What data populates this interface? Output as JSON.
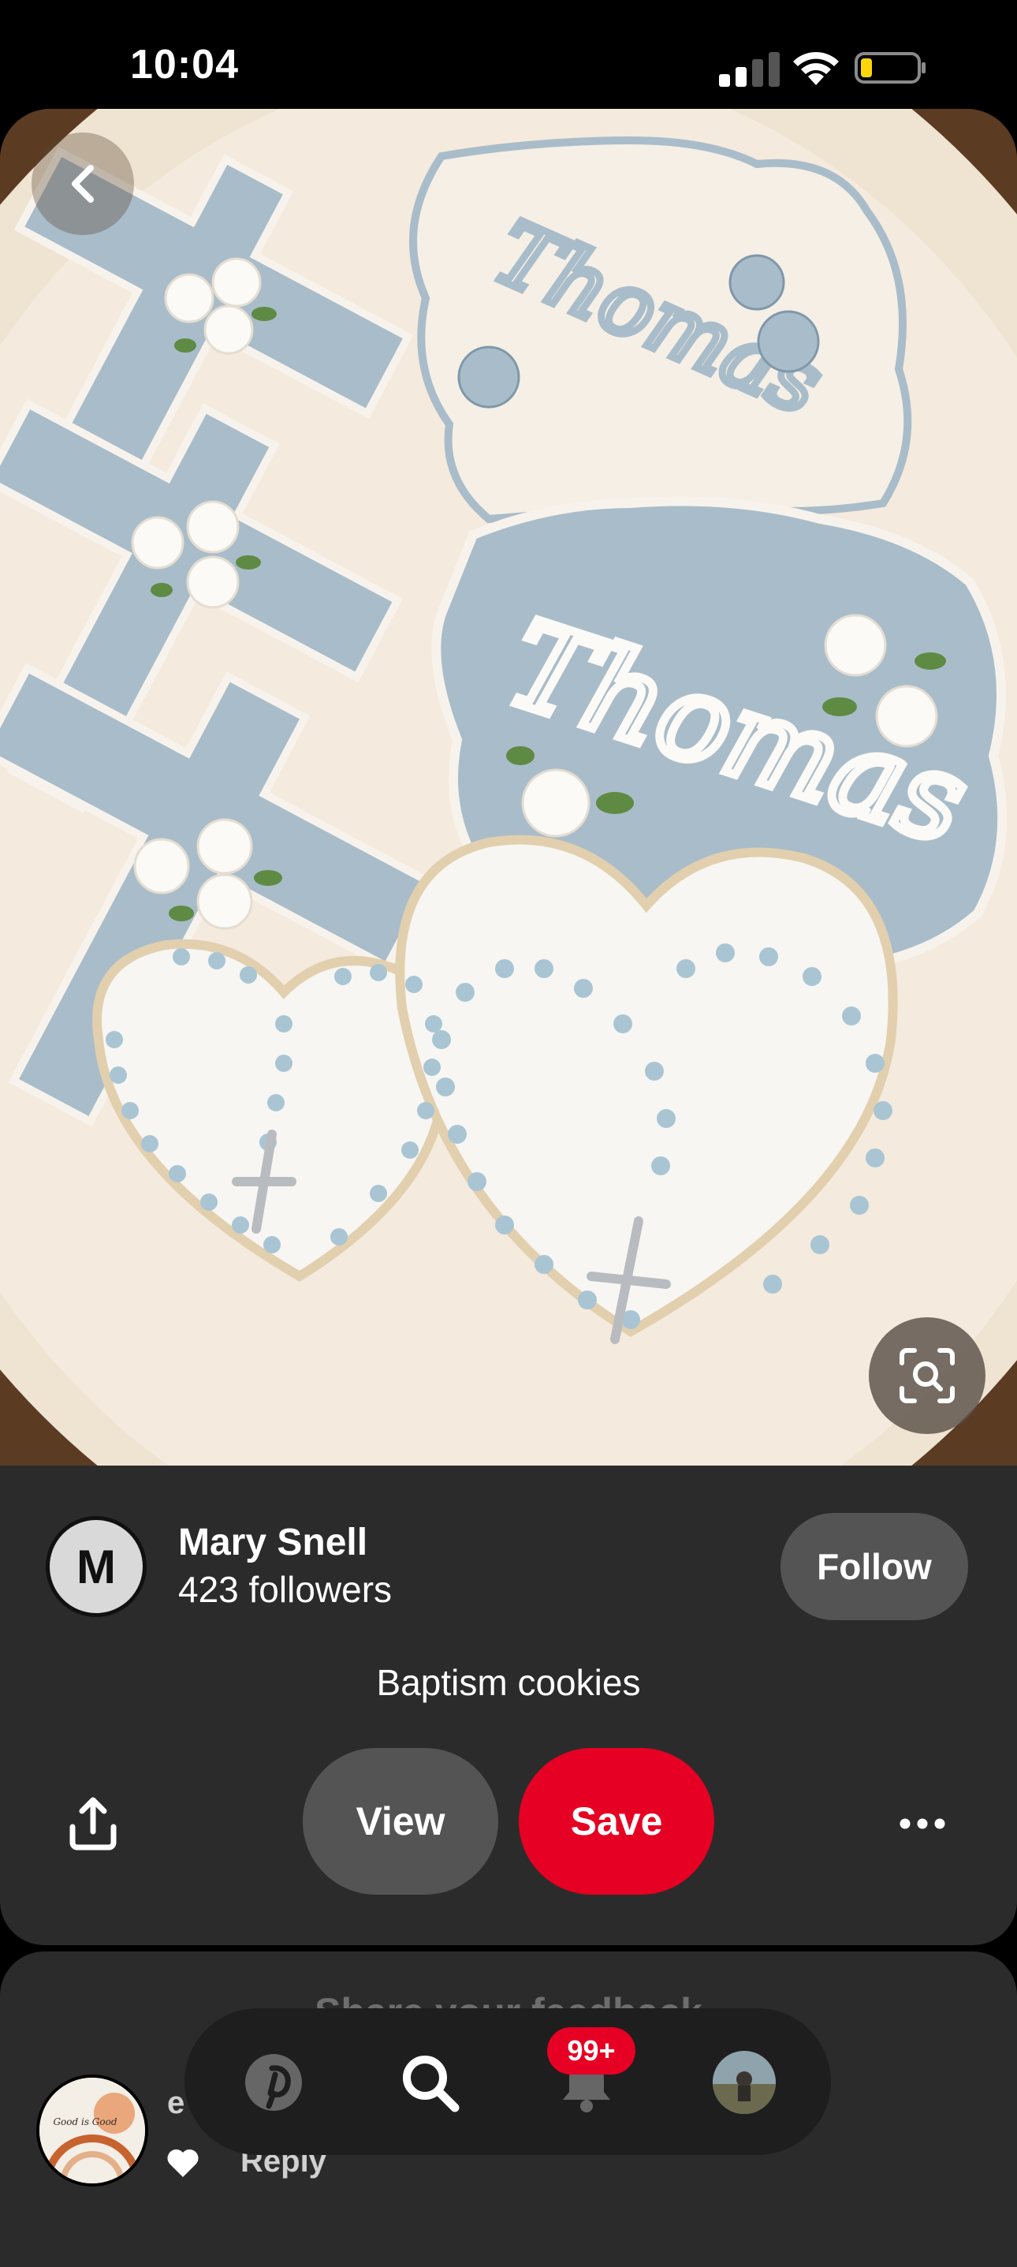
{
  "status_bar": {
    "time": "10:04"
  },
  "pin": {
    "image_alt": "Baptism cookies",
    "cookie_text_top": "Thomas",
    "cookie_text_middle": "Thomas",
    "creator": {
      "initial": "M",
      "name": "Mary Snell",
      "followers": "423 followers"
    },
    "follow_label": "Follow",
    "title": "Baptism cookies",
    "view_label": "View",
    "save_label": "Save"
  },
  "comments": {
    "heading": "Share your feedback",
    "commenter_initial": "e",
    "reply_label": "Reply",
    "avatar_text": "Good is Good"
  },
  "nav": {
    "notifications_badge": "99+"
  },
  "colors": {
    "save_red": "#e60023",
    "panel": "#2b2b2b",
    "pill": "#545454"
  },
  "icons": [
    "back-icon",
    "visual-search-icon",
    "share-icon",
    "more-icon",
    "pinterest-icon",
    "search-icon",
    "bell-icon",
    "heart-icon"
  ]
}
